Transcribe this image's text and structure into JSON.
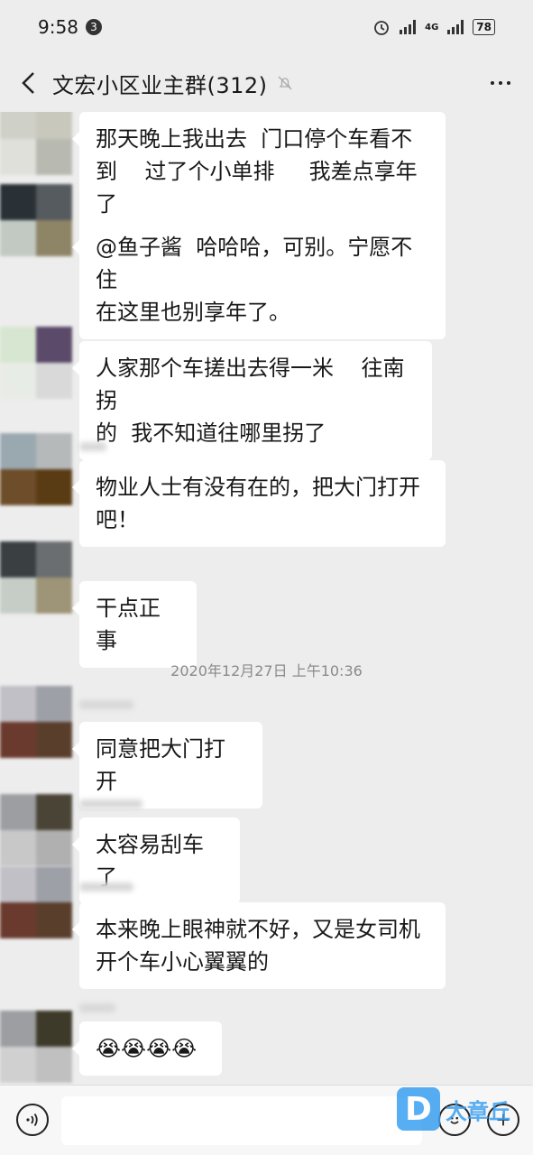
{
  "status": {
    "time": "9:58",
    "notification_count": "3",
    "network": "4G",
    "battery": "78"
  },
  "header": {
    "title": "文宏小区业主群(312)"
  },
  "messages": [
    {
      "text": "那天晚上我出去  门口停个车看不\n到    过了个小单排     我差点享年了"
    },
    {
      "text": "@鱼子酱  哈哈哈，可别。宁愿不住\n在这里也别享年了。"
    },
    {
      "text": "人家那个车搓出去得一米    往南拐\n的  我不知道往哪里拐了"
    },
    {
      "text": "物业人士有没有在的，把大门打开\n吧！"
    },
    {
      "text": "干点正事"
    },
    {
      "text": "同意把大门打开"
    },
    {
      "text": "太容易刮车了"
    },
    {
      "text": "本来晚上眼神就不好，又是女司机\n开个车小心翼翼的"
    },
    {
      "text": "😭😭😭😭"
    }
  ],
  "timestamp": "2020年12月27日 上午10:36",
  "watermark": {
    "logo": "D",
    "text": "大章丘"
  }
}
